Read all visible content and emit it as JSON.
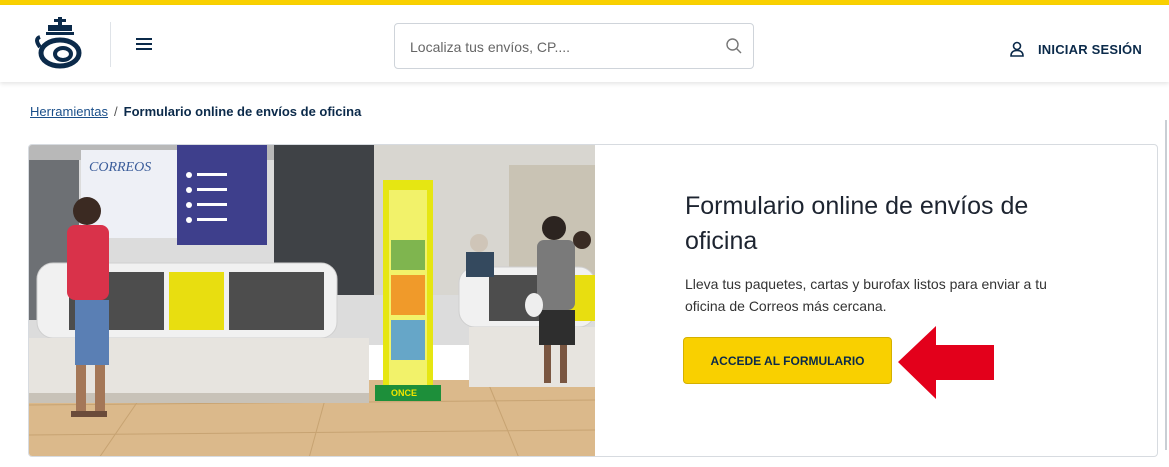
{
  "header": {
    "logo_icon": "correos-horn-crown-icon",
    "menu_icon": "hamburger-menu-icon",
    "search": {
      "placeholder": "Localiza tus envíos, CP....",
      "icon": "search-icon"
    },
    "login": {
      "icon": "user-icon",
      "label": "INICIAR SESIÓN"
    }
  },
  "breadcrumb": {
    "parent": "Herramientas",
    "separator": "/",
    "current": "Formulario online de envíos de oficina"
  },
  "card": {
    "title": "Formulario online de envíos de oficina",
    "description": "Lleva tus paquetes, cartas y burofax listos para enviar a tu oficina de Correos más cercana.",
    "button_label": "ACCEDE AL FORMULARIO",
    "photo_signs": {
      "brand": "CORREOS",
      "lottery": "ONCE"
    }
  },
  "colors": {
    "brand_yellow": "#f9d000",
    "navy": "#0b2a4a",
    "annotation_red": "#e3001b"
  }
}
